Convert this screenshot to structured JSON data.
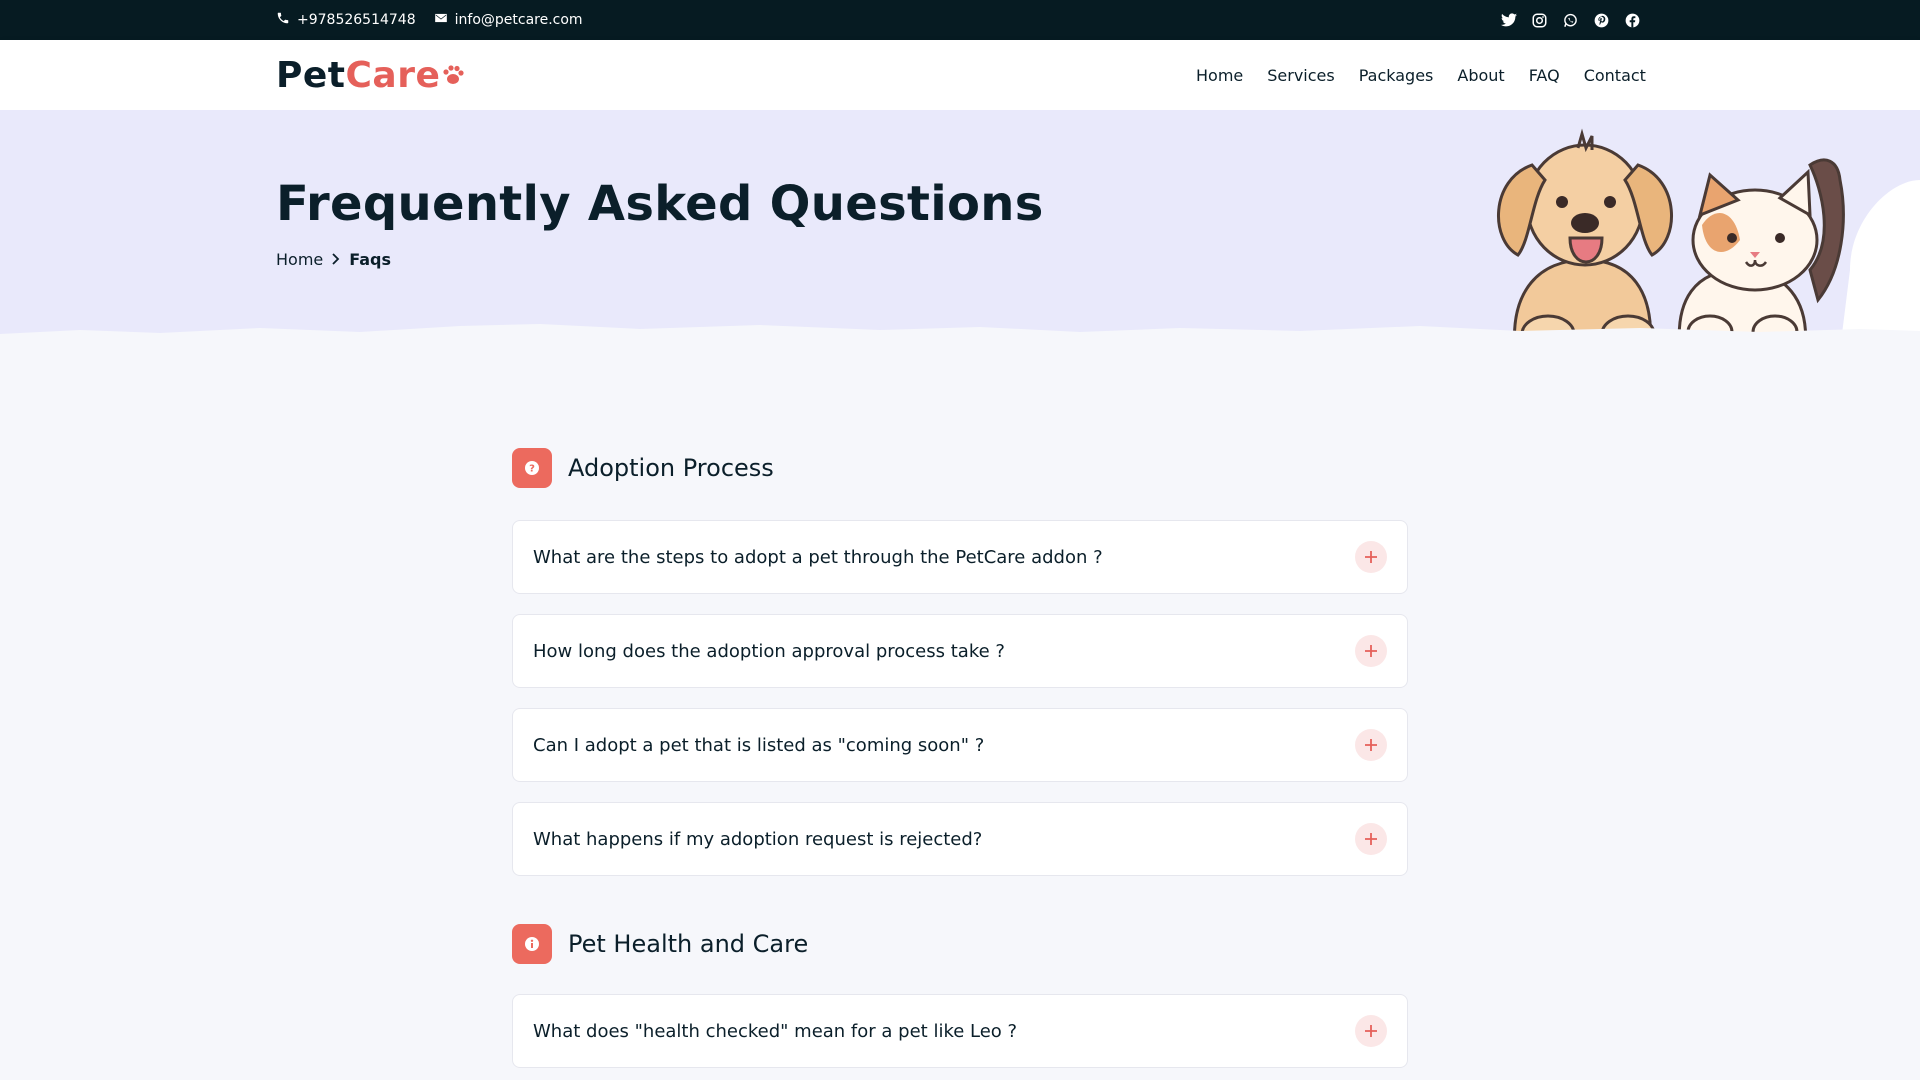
{
  "topbar": {
    "phone": "+978526514748",
    "email": "info@petcare.com",
    "social": [
      "twitter-icon",
      "instagram-icon",
      "whatsapp-icon",
      "pinterest-icon",
      "facebook-icon"
    ]
  },
  "brand": {
    "name_a": "Pet",
    "name_b": "Care",
    "accent": "#e5605a",
    "dark": "#061b22"
  },
  "nav": {
    "items": [
      "Home",
      "Services",
      "Packages",
      "About",
      "FAQ",
      "Contact"
    ]
  },
  "hero": {
    "title": "Frequently Asked Questions",
    "breadcrumb": {
      "home": "Home",
      "current": "Faqs"
    }
  },
  "sections": [
    {
      "title": "Adoption Process",
      "icon": "question-icon",
      "questions": [
        "What are the steps to adopt a pet through the PetCare addon ?",
        "How long does the adoption approval process take ?",
        "Can I adopt a pet that is listed as \"coming soon\" ?",
        "What happens if my adoption request is rejected?"
      ]
    },
    {
      "title": "Pet Health and Care",
      "icon": "info-icon",
      "questions": [
        "What does \"health checked\" mean for a pet like Leo ?"
      ]
    }
  ]
}
